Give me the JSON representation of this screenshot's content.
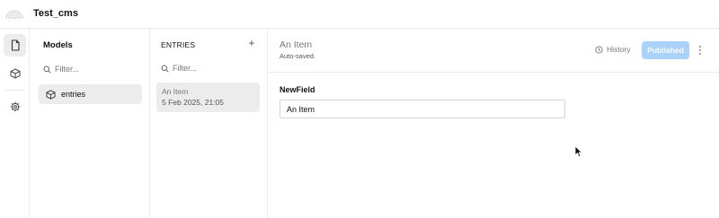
{
  "app": {
    "title": "Test_cms"
  },
  "icons": {
    "logo": "rainbow-arcs-logo",
    "rail": [
      "document-icon",
      "cube-icon",
      "gear-icon"
    ],
    "search": "search-icon",
    "model": "cube-icon",
    "history": "clock-icon",
    "more": "more-vertical-icon"
  },
  "models_panel": {
    "title": "Models",
    "filter_placeholder": "Filter...",
    "items": [
      {
        "label": "entries"
      }
    ]
  },
  "entries_panel": {
    "title": "ENTRIES",
    "add_label": "+",
    "filter_placeholder": "Filter...",
    "items": [
      {
        "title": "An Item",
        "date": "5 Feb 2025, 21:05"
      }
    ]
  },
  "document": {
    "title": "An Item",
    "status": "Auto-saved.",
    "history_label": "History",
    "publish_label": "Published",
    "fields": [
      {
        "label": "NewField",
        "value": "An Item"
      }
    ]
  },
  "colors": {
    "accent": "#a9d1fa",
    "selected_bg": "#ececec",
    "border": "#ececec"
  }
}
